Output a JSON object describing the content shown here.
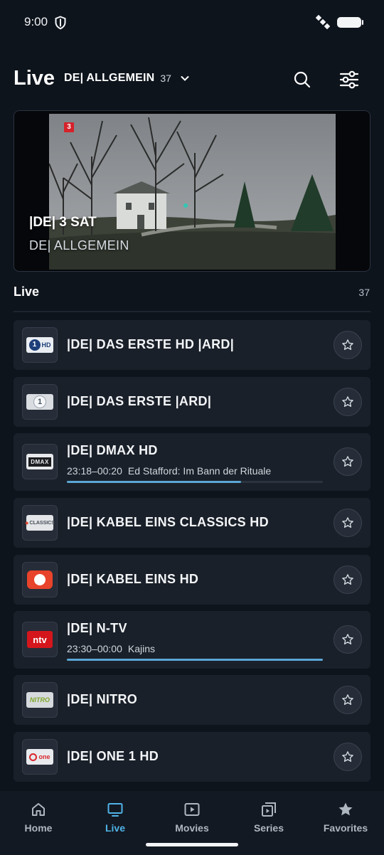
{
  "status_bar": {
    "time": "9:00",
    "icons": [
      "shield-icon",
      "satellite-icon",
      "battery-icon"
    ]
  },
  "header": {
    "title": "Live",
    "category": "DE| ALLGEMEIN",
    "category_count": "37",
    "icons": [
      "search-icon",
      "filter-icon"
    ]
  },
  "player": {
    "channel_title": "|DE| 3 SAT",
    "category": "DE| ALLGEMEIN",
    "bug": "3"
  },
  "section": {
    "title": "Live",
    "count": "37"
  },
  "channels": [
    {
      "name": "|DE| DAS ERSTE HD |ARD|",
      "logo": "ard-hd-logo"
    },
    {
      "name": "|DE| DAS ERSTE |ARD|",
      "logo": "ard-logo"
    },
    {
      "name": "|DE| DMAX HD",
      "logo": "dmax-logo",
      "epg_time": "23:18–00:20",
      "epg_title": "Ed Stafford: Im Bann der Rituale",
      "progress": 0.68
    },
    {
      "name": "|DE| KABEL EINS CLASSICS HD",
      "logo": "kabel-eins-classics-logo"
    },
    {
      "name": "|DE| KABEL EINS HD",
      "logo": "kabel-eins-logo"
    },
    {
      "name": "|DE| N-TV",
      "logo": "ntv-logo",
      "epg_time": "23:30–00:00",
      "epg_title": "Kajins",
      "progress": 1.0
    },
    {
      "name": "|DE| NITRO",
      "logo": "nitro-logo"
    },
    {
      "name": "|DE| ONE 1 HD",
      "logo": "one-logo"
    }
  ],
  "nav": [
    {
      "label": "Home",
      "icon": "home-icon"
    },
    {
      "label": "Live",
      "icon": "tv-icon",
      "active": true
    },
    {
      "label": "Movies",
      "icon": "play-icon"
    },
    {
      "label": "Series",
      "icon": "series-icon"
    },
    {
      "label": "Favorites",
      "icon": "star-icon"
    }
  ],
  "colors": {
    "background": "#0e141c",
    "card": "#1a2029",
    "accent": "#4fb3e8",
    "progress": "#5aa7d6"
  }
}
